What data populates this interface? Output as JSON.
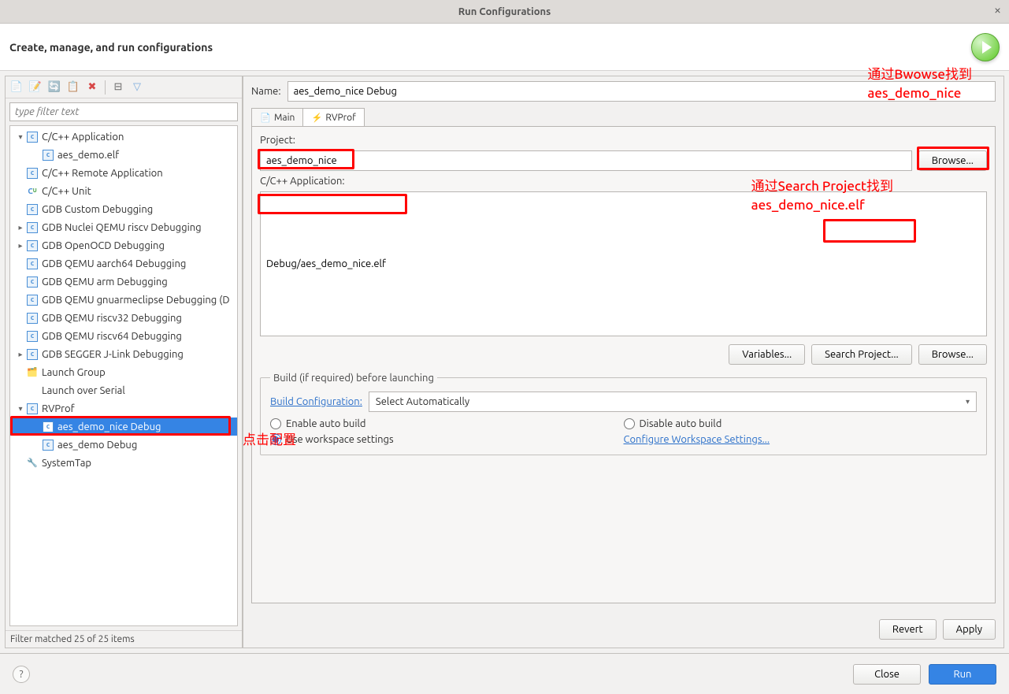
{
  "window": {
    "title": "Run Configurations"
  },
  "header": {
    "title": "Create, manage, and run configurations"
  },
  "filter": {
    "placeholder": "type filter text"
  },
  "tree": [
    {
      "label": "C/C++ Application",
      "depth": 0,
      "twisty": "▾",
      "icon": "c",
      "expanded": true
    },
    {
      "label": "aes_demo.elf",
      "depth": 1,
      "twisty": "",
      "icon": "c"
    },
    {
      "label": "C/C++ Remote Application",
      "depth": 0,
      "twisty": "·",
      "icon": "c"
    },
    {
      "label": "C/C++ Unit",
      "depth": 0,
      "twisty": "·",
      "icon": "cu"
    },
    {
      "label": "GDB Custom Debugging",
      "depth": 0,
      "twisty": "·",
      "icon": "c"
    },
    {
      "label": "GDB Nuclei QEMU riscv Debugging",
      "depth": 0,
      "twisty": "▸",
      "icon": "c"
    },
    {
      "label": "GDB OpenOCD Debugging",
      "depth": 0,
      "twisty": "▸",
      "icon": "c"
    },
    {
      "label": "GDB QEMU aarch64 Debugging",
      "depth": 0,
      "twisty": "·",
      "icon": "c"
    },
    {
      "label": "GDB QEMU arm Debugging",
      "depth": 0,
      "twisty": "·",
      "icon": "c"
    },
    {
      "label": "GDB QEMU gnuarmeclipse Debugging (D",
      "depth": 0,
      "twisty": "·",
      "icon": "c"
    },
    {
      "label": "GDB QEMU riscv32 Debugging",
      "depth": 0,
      "twisty": "·",
      "icon": "c"
    },
    {
      "label": "GDB QEMU riscv64 Debugging",
      "depth": 0,
      "twisty": "·",
      "icon": "c"
    },
    {
      "label": "GDB SEGGER J-Link Debugging",
      "depth": 0,
      "twisty": "▸",
      "icon": "c"
    },
    {
      "label": "Launch Group",
      "depth": 0,
      "twisty": "·",
      "icon": "lg"
    },
    {
      "label": "Launch over Serial",
      "depth": 0,
      "twisty": "·",
      "icon": "blank"
    },
    {
      "label": "RVProf",
      "depth": 0,
      "twisty": "▾",
      "icon": "c"
    },
    {
      "label": "aes_demo_nice Debug",
      "depth": 1,
      "twisty": "",
      "icon": "c",
      "selected": true
    },
    {
      "label": "aes_demo Debug",
      "depth": 1,
      "twisty": "",
      "icon": "c"
    },
    {
      "label": "SystemTap",
      "depth": 0,
      "twisty": "·",
      "icon": "st"
    }
  ],
  "filter_status": "Filter matched 25 of 25 items",
  "form": {
    "name_label": "Name:",
    "name_value": "aes_demo_nice Debug",
    "tabs": {
      "main": "Main",
      "rvprof": "RVProf"
    },
    "project_label": "Project:",
    "project_value": "aes_demo_nice",
    "browse_project": "Browse...",
    "app_label": "C/C++ Application:",
    "app_value": "Debug/aes_demo_nice.elf",
    "variables": "Variables...",
    "search_project": "Search Project...",
    "browse_app": "Browse...",
    "build_legend": "Build (if required) before launching",
    "build_config_label": "Build Configuration:",
    "build_config_value": "Select Automatically",
    "enable_auto": "Enable auto build",
    "disable_auto": "Disable auto build",
    "use_workspace": "Use workspace settings",
    "configure_ws": "Configure Workspace Settings..."
  },
  "buttons": {
    "revert": "Revert",
    "apply": "Apply",
    "close": "Close",
    "run": "Run"
  },
  "annotations": {
    "ann1_line1": "通过Bwowse找到",
    "ann1_line2": "aes_demo_nice",
    "ann2_line1": "通过Search Project找到",
    "ann2_line2": "aes_demo_nice.elf",
    "ann3": "点击配置"
  }
}
